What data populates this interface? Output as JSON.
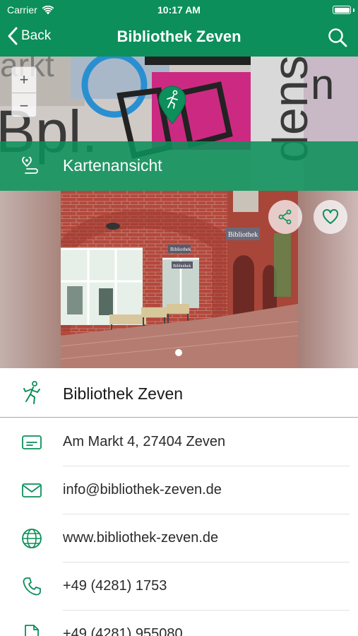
{
  "status_bar": {
    "carrier": "Carrier",
    "time": "10:17 AM"
  },
  "nav": {
    "back_label": "Back",
    "title": "Bibliothek Zeven"
  },
  "map": {
    "zoom_in": "+",
    "zoom_out": "−",
    "view_label": "Kartenansicht"
  },
  "gallery": {
    "photo_sign_1": "Bibliothek",
    "photo_sign_2": "Bibliothek",
    "photo_sign_3": "Bibliothek",
    "page_count": 1,
    "current_page": 1
  },
  "details": {
    "name": "Bibliothek Zeven",
    "address": "Am Markt 4, 27404 Zeven",
    "email": "info@bibliothek-zeven.de",
    "website": "www.bibliothek-zeven.de",
    "phone": "+49 (4281) 1753",
    "fax": "+49 (4281) 955080"
  },
  "colors": {
    "accent": "#0c8f5a",
    "text": "#1a1a1a",
    "separator": "#e3e3e3"
  },
  "icons": {
    "name": "hiking-person-icon",
    "address": "address-card-icon",
    "email": "envelope-icon",
    "website": "globe-icon",
    "phone": "phone-icon",
    "fax": "document-icon"
  }
}
